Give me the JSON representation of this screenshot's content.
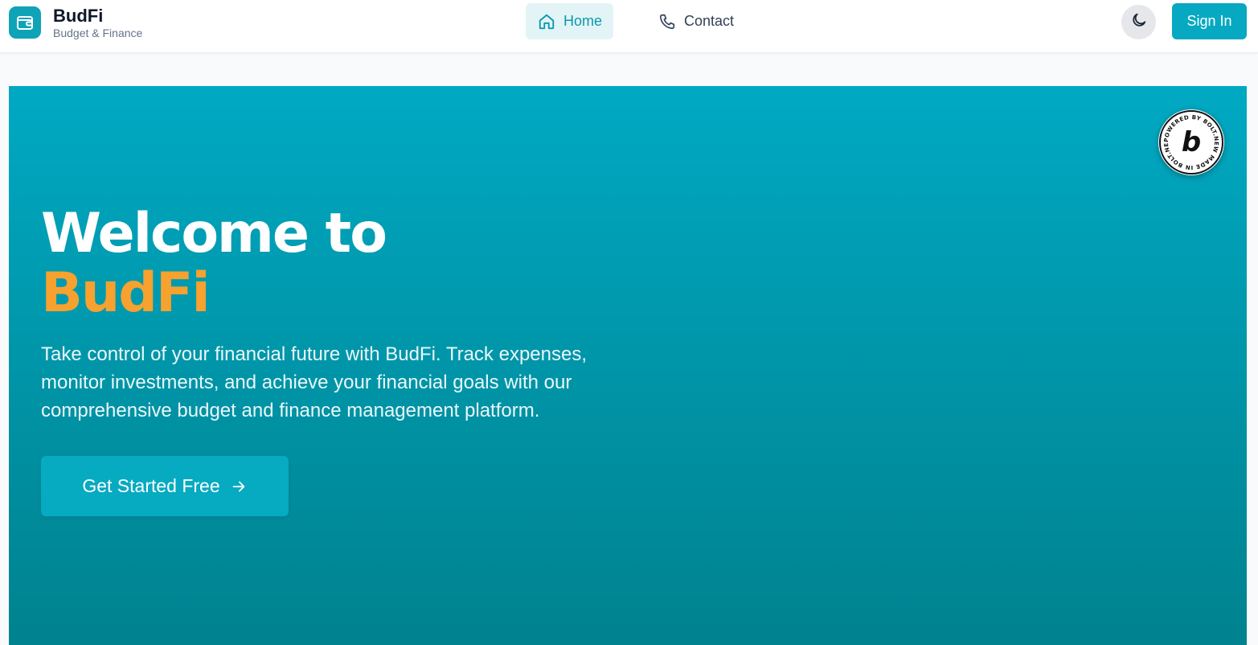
{
  "brand": {
    "name": "BudFi",
    "subtitle": "Budget & Finance",
    "accent_color": "#0fa3b8"
  },
  "nav": {
    "items": [
      {
        "label": "Home",
        "icon": "home-icon",
        "active": true
      },
      {
        "label": "Contact",
        "icon": "phone-icon",
        "active": false
      }
    ]
  },
  "header_actions": {
    "theme_icon": "moon-icon",
    "signin_label": "Sign In"
  },
  "hero": {
    "title_line1": "Welcome to",
    "title_line2": "BudFi",
    "description": "Take control of your financial future with BudFi. Track expenses, monitor investments, and achieve your financial goals with our comprehensive budget and finance management platform.",
    "cta_label": "Get Started Free",
    "cta_icon": "arrow-right-icon",
    "gradient_top": "#00a9c3",
    "gradient_bottom": "#00828f",
    "title_accent_color": "#f7a12f"
  },
  "badge": {
    "text": "POWERED BY BOLT.NEW MADE IN BOLT.NEW",
    "letter": "b"
  }
}
